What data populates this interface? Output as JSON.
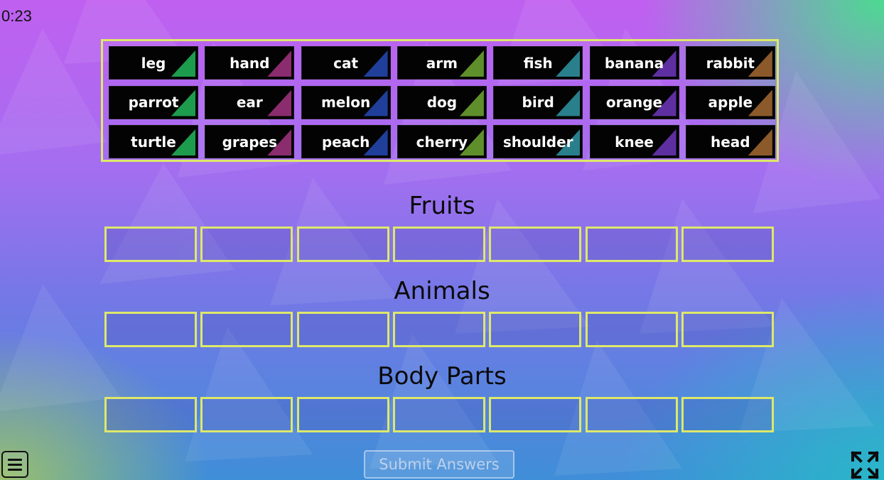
{
  "timer": "0:23",
  "word_bank": [
    [
      "leg",
      "hand",
      "cat",
      "arm",
      "fish",
      "banana",
      "rabbit"
    ],
    [
      "parrot",
      "ear",
      "melon",
      "dog",
      "bird",
      "orange",
      "apple"
    ],
    [
      "turtle",
      "grapes",
      "peach",
      "cherry",
      "shoulder",
      "knee",
      "head"
    ]
  ],
  "tile_colors": [
    "#1e9c4e",
    "#8a2c6e",
    "#1f3f9a",
    "#5f8f2a",
    "#2a7f8c",
    "#5e2fa0",
    "#8c5a2a"
  ],
  "categories": [
    {
      "name": "Fruits"
    },
    {
      "name": "Animals"
    },
    {
      "name": "Body Parts"
    }
  ],
  "submit_label": "Submit Answers",
  "accent_color": "#dde86a",
  "icons": {
    "menu": "hamburger-menu-icon",
    "fullscreen": "fullscreen-icon"
  }
}
